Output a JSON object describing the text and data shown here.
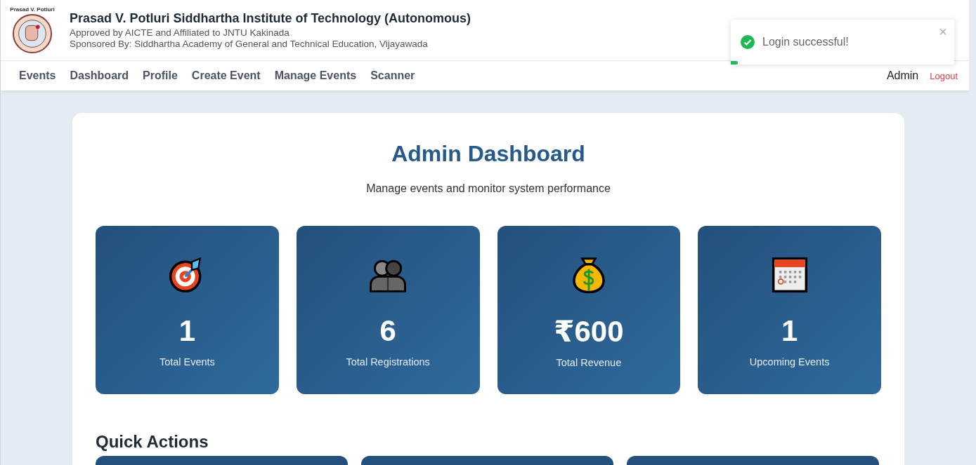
{
  "header": {
    "logo_caption": "Prasad V. Potluri",
    "title": "Prasad V. Potluri Siddhartha Institute of Technology (Autonomous)",
    "subtitle": "Approved by AICTE and Affiliated to JNTU Kakinada",
    "sponsor": "Sponsored By: Siddhartha Academy of General and Technical Education, Vijayawada"
  },
  "nav": {
    "items": [
      "Events",
      "Dashboard",
      "Profile",
      "Create Event",
      "Manage Events",
      "Scanner"
    ],
    "user": "Admin",
    "logout": "Logout"
  },
  "toast": {
    "message": "Login successful!",
    "close": "×",
    "level": 0.03
  },
  "dashboard": {
    "title": "Admin Dashboard",
    "subtitle": "Manage events and monitor system performance",
    "stats": [
      {
        "value": "1",
        "label": "Total Events"
      },
      {
        "value": "6",
        "label": "Total Registrations"
      },
      {
        "value": "₹600",
        "label": "Total Revenue"
      },
      {
        "value": "1",
        "label": "Upcoming Events"
      }
    ],
    "quick_actions_title": "Quick Actions"
  }
}
